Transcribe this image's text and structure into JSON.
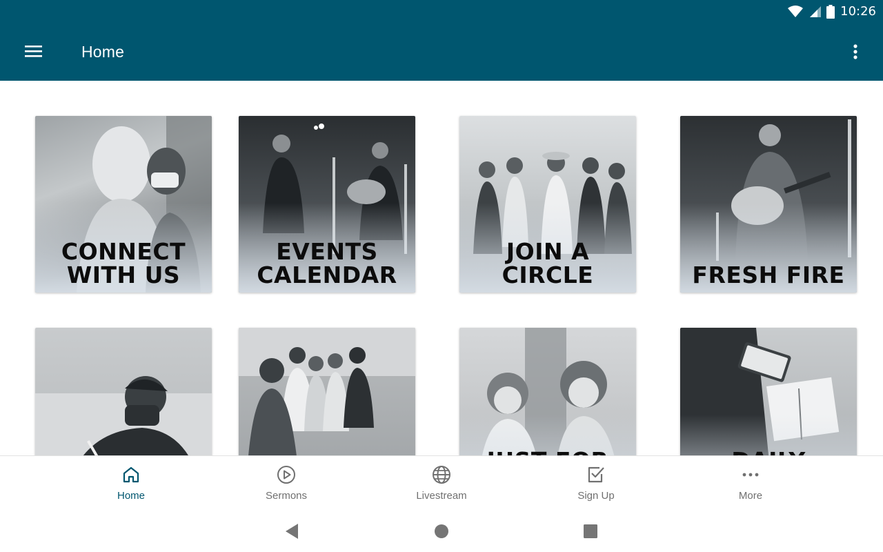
{
  "status_bar": {
    "time": "10:26"
  },
  "app_bar": {
    "title": "Home",
    "menu_icon": "hamburger-menu-icon",
    "overflow_icon": "more-vert-icon"
  },
  "tiles": [
    {
      "label": "CONNECT\nWITH US"
    },
    {
      "label": "EVENTS\nCALENDAR"
    },
    {
      "label": "JOIN A\nCIRCLE"
    },
    {
      "label": "FRESH FIRE"
    },
    {
      "label": ""
    },
    {
      "label": ""
    },
    {
      "label": "JUST FOR"
    },
    {
      "label": "DAILY"
    }
  ],
  "bottom_nav": {
    "items": [
      {
        "label": "Home",
        "icon": "home-icon",
        "active": true
      },
      {
        "label": "Sermons",
        "icon": "play-circle-icon",
        "active": false
      },
      {
        "label": "Livestream",
        "icon": "globe-icon",
        "active": false
      },
      {
        "label": "Sign Up",
        "icon": "checkbox-icon",
        "active": false
      },
      {
        "label": "More",
        "icon": "more-horiz-icon",
        "active": false
      }
    ]
  },
  "colors": {
    "primary": "#00566f",
    "active_nav": "#00566f",
    "inactive_nav": "#707070"
  }
}
